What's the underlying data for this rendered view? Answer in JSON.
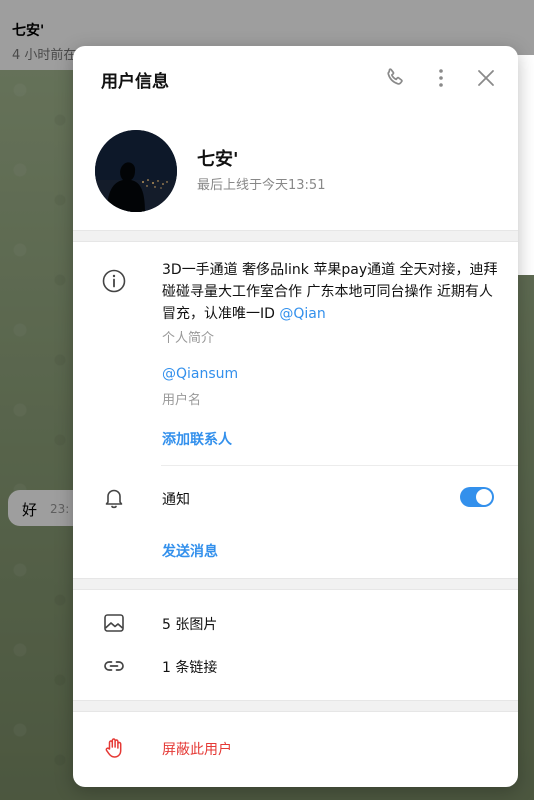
{
  "background": {
    "chat_name": "七安'",
    "chat_status": "4 小时前在",
    "bubble_text": "好",
    "bubble_time": "23:"
  },
  "modal": {
    "title": "用户信息",
    "icons": [
      "phone-icon",
      "more-vertical-icon",
      "close-icon"
    ]
  },
  "profile": {
    "name": "七安'",
    "last_seen": "最后上线于今天13:51"
  },
  "bio": {
    "text": "3D一手通道 奢侈品link 苹果pay通道 全天对接，迪拜碰碰寻量大工作室合作 广东本地可同台操作 近期有人冒充，认准唯一ID ",
    "mention": "@Qian",
    "label": "个人简介"
  },
  "username": {
    "value": "@Qiansum",
    "label": "用户名"
  },
  "actions": {
    "add_contact": "添加联系人",
    "send_message": "发送消息"
  },
  "notifications": {
    "label": "通知",
    "enabled": true
  },
  "media": {
    "photos": "5 张图片",
    "links": "1 条链接"
  },
  "block": {
    "label": "屏蔽此用户"
  },
  "colors": {
    "accent": "#3390ec",
    "danger": "#e53935"
  }
}
